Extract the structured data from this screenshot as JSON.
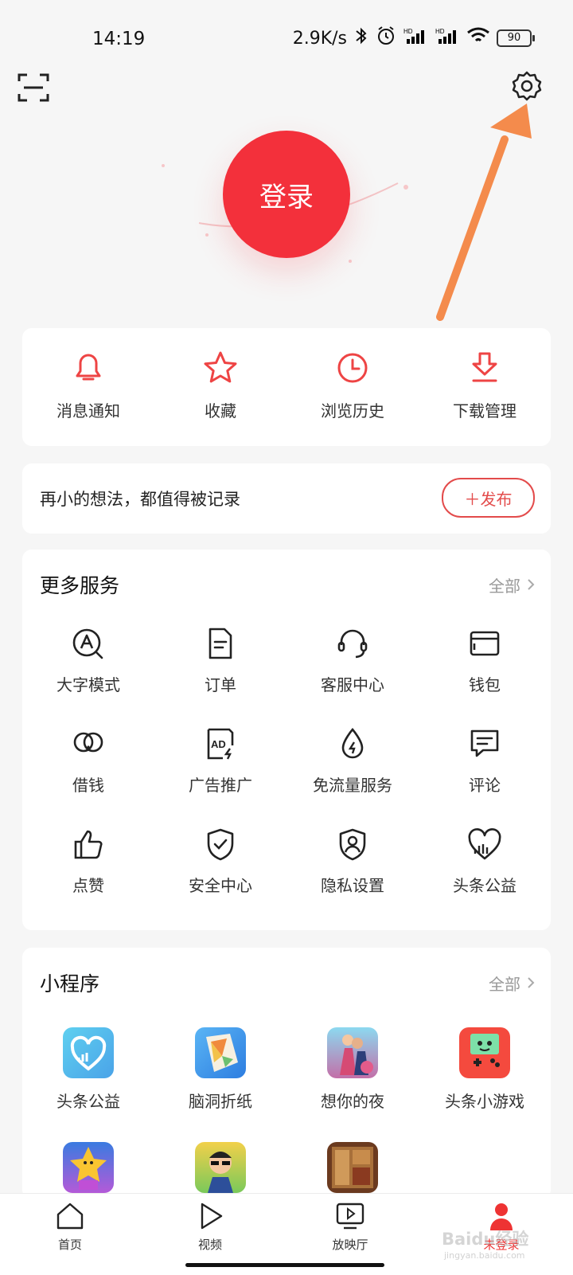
{
  "status_bar": {
    "time": "14:19",
    "network_speed": "2.9K/s",
    "battery": "90",
    "icons": [
      "bluetooth-icon",
      "alarm-icon",
      "signal-hd-icon",
      "signal-hd-icon",
      "wifi-icon",
      "battery-icon"
    ]
  },
  "header": {
    "scan_icon": "scan-icon",
    "settings_icon": "gear-icon",
    "login_label": "登录"
  },
  "quick_actions": [
    {
      "label": "消息通知",
      "icon": "bell-icon"
    },
    {
      "label": "收藏",
      "icon": "star-icon"
    },
    {
      "label": "浏览历史",
      "icon": "clock-icon"
    },
    {
      "label": "下载管理",
      "icon": "download-icon"
    }
  ],
  "post_prompt": {
    "text": "再小的想法，都值得被记录",
    "button": "＋发布"
  },
  "services": {
    "title": "更多服务",
    "all_label": "全部",
    "items": [
      {
        "label": "大字模式",
        "icon": "large-text-icon"
      },
      {
        "label": "订单",
        "icon": "order-icon"
      },
      {
        "label": "客服中心",
        "icon": "headset-icon"
      },
      {
        "label": "钱包",
        "icon": "wallet-icon"
      },
      {
        "label": "借钱",
        "icon": "loan-icon"
      },
      {
        "label": "广告推广",
        "icon": "ad-icon"
      },
      {
        "label": "免流量服务",
        "icon": "data-free-icon"
      },
      {
        "label": "评论",
        "icon": "comment-icon"
      },
      {
        "label": "点赞",
        "icon": "thumbs-up-icon"
      },
      {
        "label": "安全中心",
        "icon": "shield-icon"
      },
      {
        "label": "隐私设置",
        "icon": "privacy-icon"
      },
      {
        "label": "头条公益",
        "icon": "charity-icon"
      }
    ]
  },
  "mini_programs": {
    "title": "小程序",
    "all_label": "全部",
    "items": [
      {
        "label": "头条公益",
        "icon": "charity-app-icon"
      },
      {
        "label": "脑洞折纸",
        "icon": "origami-app-icon"
      },
      {
        "label": "想你的夜",
        "icon": "couple-app-icon"
      },
      {
        "label": "头条小游戏",
        "icon": "gameboy-app-icon"
      },
      {
        "label": "",
        "icon": "star-game-icon"
      },
      {
        "label": "",
        "icon": "money-game-icon"
      },
      {
        "label": "",
        "icon": "wood-game-icon"
      }
    ]
  },
  "bottom_nav": [
    {
      "label": "首页",
      "icon": "home-icon"
    },
    {
      "label": "视频",
      "icon": "play-icon"
    },
    {
      "label": "放映厅",
      "icon": "tv-icon"
    },
    {
      "label": "未登录",
      "icon": "user-icon"
    }
  ],
  "watermark": {
    "text": "Baidu经验",
    "sub": "jingyan.baidu.com"
  },
  "colors": {
    "accent": "#f3303b",
    "publish": "#e34b4b",
    "arrow": "#f48b4c"
  }
}
